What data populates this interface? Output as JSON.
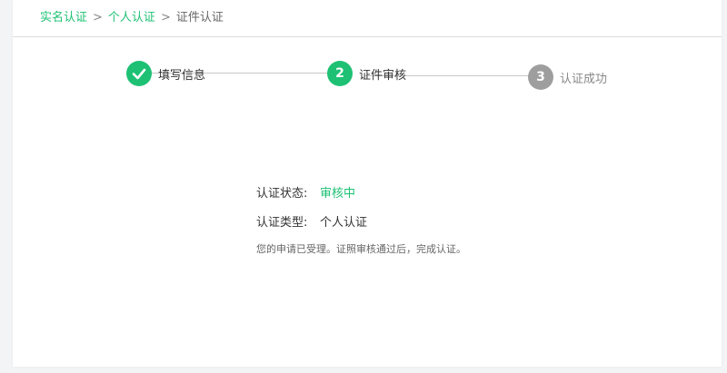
{
  "breadcrumb": {
    "items": [
      "实名认证",
      "个人认证"
    ],
    "separator": ">",
    "current": "证件认证"
  },
  "steps": [
    {
      "number": "",
      "label": "填写信息",
      "state": "done"
    },
    {
      "number": "2",
      "label": "证件审核",
      "state": "active"
    },
    {
      "number": "3",
      "label": "认证成功",
      "state": "pending"
    }
  ],
  "status": {
    "status_label": "认证状态:",
    "status_value": "审核中",
    "type_label": "认证类型:",
    "type_value": "个人认证",
    "note": "您的申请已受理。证照审核通过后，完成认证。"
  },
  "colors": {
    "accent": "#1ec174",
    "pending": "#9e9e9e",
    "text": "#333333",
    "muted": "#666666"
  }
}
